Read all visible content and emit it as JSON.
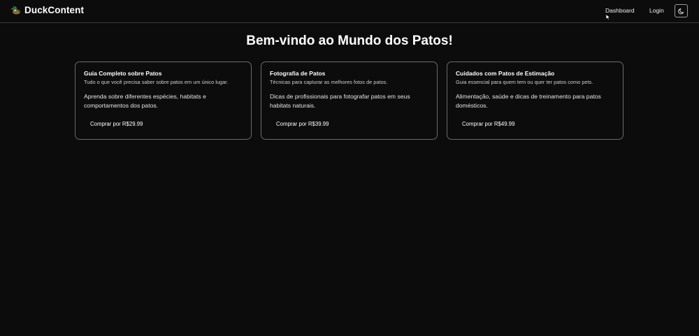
{
  "header": {
    "brand_name": "DuckContent",
    "brand_icon": "duck-icon",
    "nav": {
      "dashboard_label": "Dashboard",
      "login_label": "Login"
    },
    "theme_toggle_icon": "moon-icon"
  },
  "main": {
    "title": "Bem-vindo ao Mundo dos Patos!",
    "cards": [
      {
        "title": "Guia Completo sobre Patos",
        "subtitle": "Tudo o que você precisa saber sobre patos em um único lugar.",
        "body": "Aprenda sobre diferentes espécies, habitats e comportamentos dos patos.",
        "button_label": "Comprar por R$29.99"
      },
      {
        "title": "Fotografia de Patos",
        "subtitle": "Técnicas para capturar as melhores fotos de patos.",
        "body": "Dicas de profissionais para fotografar patos em seus habitats naturais.",
        "button_label": "Comprar por R$39.99"
      },
      {
        "title": "Cuidados com Patos de Estimação",
        "subtitle": "Guia essencial para quem tem ou quer ter patos como pets.",
        "body": "Alimentação, saúde e dicas de treinamento para patos domésticos.",
        "button_label": "Comprar por R$49.99"
      }
    ]
  },
  "colors": {
    "background": "#0c0c0c",
    "text": "#ffffff",
    "card_border": "#6a6a6a",
    "header_border": "#3a3a3a"
  }
}
